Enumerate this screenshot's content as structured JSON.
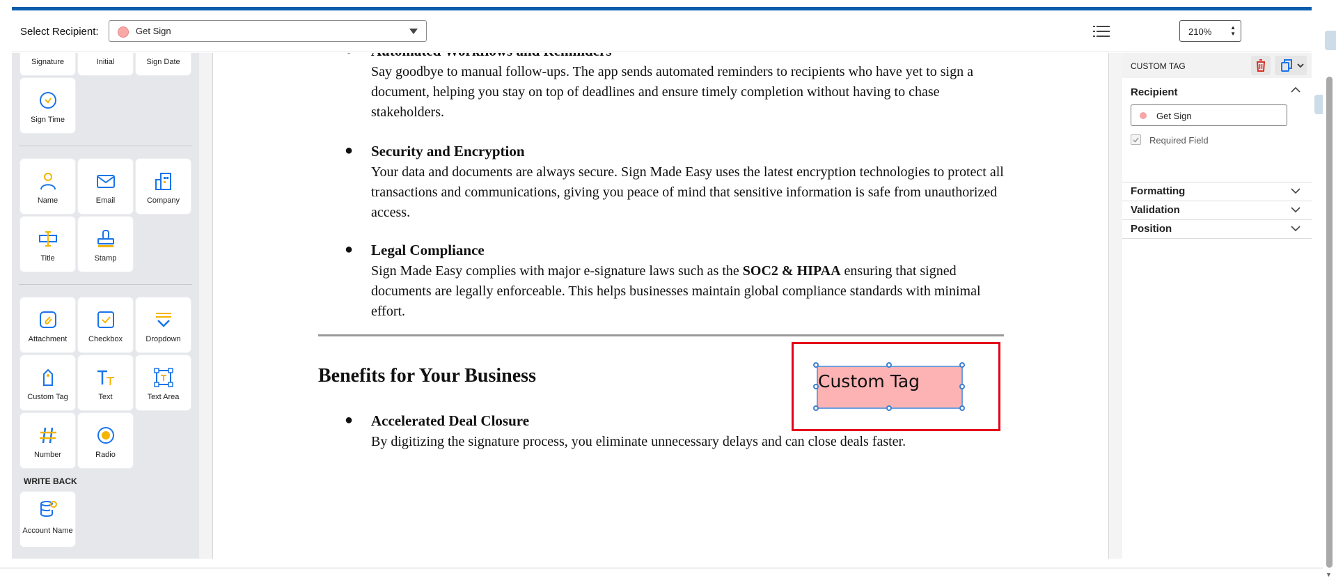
{
  "toolbar": {
    "recipient_label": "Select Recipient:",
    "recipient_value": "Get Sign",
    "zoom_value": "210%"
  },
  "sidebar": {
    "row0": [
      "Signature",
      "Initial",
      "Sign Date"
    ],
    "sign_time": "Sign Time",
    "group2": [
      "Name",
      "Email",
      "Company",
      "Title",
      "Stamp"
    ],
    "group3": [
      "Attachment",
      "Checkbox",
      "Dropdown",
      "Custom Tag",
      "Text",
      "Text Area",
      "Number",
      "Radio"
    ],
    "write_back_title": "WRITE BACK",
    "write_back_item": "Account Name"
  },
  "document": {
    "item1_heading": "Automated Workflows and Reminders",
    "item1_body": "Say goodbye to manual follow-ups. The app sends automated reminders to recipients who have yet to sign a document, helping you stay on top of deadlines and ensure timely completion without having to chase stakeholders.",
    "item2_heading": "Security and Encryption",
    "item2_body": "Your data and documents are always secure. Sign Made Easy uses the latest encryption technologies to protect all transactions and communications, giving you peace of mind that sensitive information is safe from unauthorized access.",
    "item3_heading": "Legal Compliance",
    "item3_body_pre": "Sign Made Easy complies with major e-signature laws such as the ",
    "item3_body_bold": "SOC2 & HIPAA",
    "item3_body_post": " ensuring that signed documents are legally enforceable. This helps businesses maintain global compliance standards with minimal effort.",
    "section_heading": "Benefits for Your Business",
    "item4_heading": "Accelerated Deal Closure",
    "item4_body": "By digitizing the signature process, you eliminate unnecessary delays and can close deals faster.",
    "bullet": "●"
  },
  "custom_tag_field": {
    "label": "Custom Tag",
    "fill_color": "#fdb2b4",
    "highlight_color": "#e3001b"
  },
  "properties_panel": {
    "title": "CUSTOM TAG",
    "recipient_section": "Recipient",
    "recipient_value": "Get Sign",
    "required_label": "Required Field",
    "formatting_section": "Formatting",
    "validation_section": "Validation",
    "position_section": "Position"
  },
  "colors": {
    "accent_blue": "#0b5cad",
    "icon_blue": "#1a73e8",
    "icon_orange": "#f4b400",
    "delete_red": "#d93025"
  }
}
